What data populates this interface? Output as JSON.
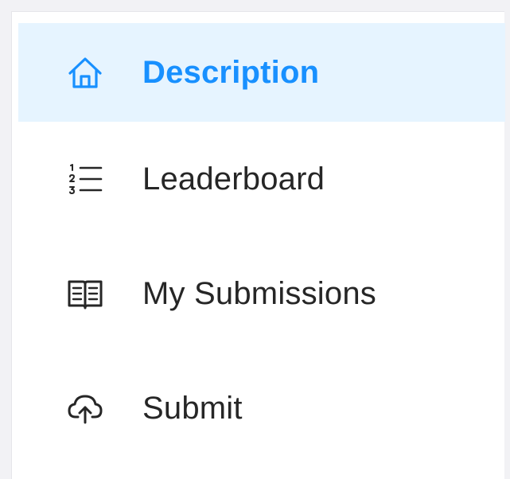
{
  "menu": {
    "items": [
      {
        "label": "Description",
        "icon": "home-icon",
        "active": true
      },
      {
        "label": "Leaderboard",
        "icon": "ordered-list-icon",
        "active": false
      },
      {
        "label": "My Submissions",
        "icon": "book-icon",
        "active": false
      },
      {
        "label": "Submit",
        "icon": "cloud-upload-icon",
        "active": false
      }
    ]
  },
  "colors": {
    "active_text": "#1890ff",
    "active_background": "#e6f4ff",
    "text": "#262626",
    "page_background": "#f2f2f5"
  }
}
